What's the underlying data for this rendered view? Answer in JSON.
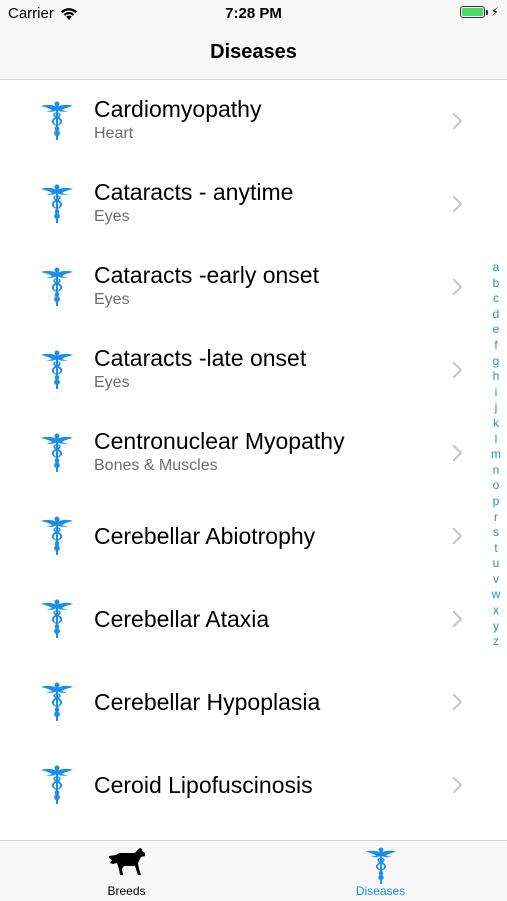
{
  "status_bar": {
    "carrier": "Carrier",
    "time": "7:28 PM",
    "battery_level": 1.0,
    "battery_color": "#4cd964",
    "icons": [
      "wifi-icon",
      "battery-icon",
      "charging-bolt-icon"
    ]
  },
  "nav": {
    "title": "Diseases"
  },
  "diseases": [
    {
      "name": "Cardiomyopathy",
      "category": "Heart"
    },
    {
      "name": "Cataracts - anytime",
      "category": "Eyes"
    },
    {
      "name": "Cataracts -early onset",
      "category": "Eyes"
    },
    {
      "name": "Cataracts -late onset",
      "category": "Eyes"
    },
    {
      "name": "Centronuclear Myopathy",
      "category": "Bones & Muscles"
    },
    {
      "name": "Cerebellar Abiotrophy",
      "category": ""
    },
    {
      "name": "Cerebellar Ataxia",
      "category": ""
    },
    {
      "name": "Cerebellar Hypoplasia",
      "category": ""
    },
    {
      "name": "Ceroid Lipofuscinosis",
      "category": ""
    }
  ],
  "row_icon": "caduceus-icon",
  "index_letters": [
    "a",
    "b",
    "c",
    "d",
    "e",
    "f",
    "g",
    "h",
    "i",
    "j",
    "k",
    "l",
    "m",
    "n",
    "o",
    "p",
    "r",
    "s",
    "t",
    "u",
    "v",
    "w",
    "x",
    "y",
    "z"
  ],
  "tab_bar": {
    "tabs": [
      {
        "label": "Breeds",
        "icon": "dog-icon",
        "selected": false
      },
      {
        "label": "Diseases",
        "icon": "caduceus-icon",
        "selected": true
      }
    ]
  },
  "colors": {
    "accent": "#1a8ee8",
    "bar_background": "#f7f7f7",
    "subtitle": "#6d6d6d",
    "chevron": "#c7c7cc"
  }
}
